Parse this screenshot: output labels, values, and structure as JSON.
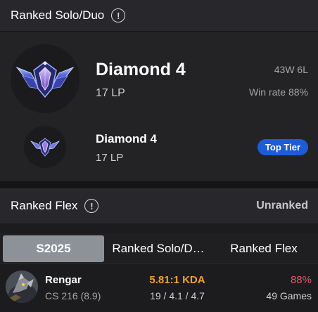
{
  "solo_duo": {
    "title": "Ranked Solo/Duo",
    "info_icon": "!",
    "tier": "Diamond 4",
    "lp": "17 LP",
    "record": "43W 6L",
    "win_rate": "Win rate 88%",
    "peak_tier": "Diamond 4",
    "peak_lp": "17 LP",
    "badge": "Top Tier"
  },
  "flex": {
    "title": "Ranked Flex",
    "info_icon": "!",
    "status": "Unranked"
  },
  "tabs": [
    {
      "label": "S2025",
      "selected": true
    },
    {
      "label": "Ranked Solo/D…",
      "selected": false
    },
    {
      "label": "Ranked Flex",
      "selected": false
    }
  ],
  "champion": {
    "name": "Rengar",
    "cs": "CS 216 (8.9)",
    "kda": "5.81:1 KDA",
    "kda_detail": "19 / 4.1 / 4.7",
    "win_rate": "88%",
    "games": "49 Games"
  },
  "colors": {
    "badge_blue": "#1e5bd6",
    "kda_orange": "#f0a12e",
    "winrate_red": "#e05a67",
    "selected_tab": "#8d9298"
  },
  "icons": {
    "tier_emblem": "diamond-emblem-icon",
    "info": "info-icon",
    "champion": "rengar-portrait"
  }
}
